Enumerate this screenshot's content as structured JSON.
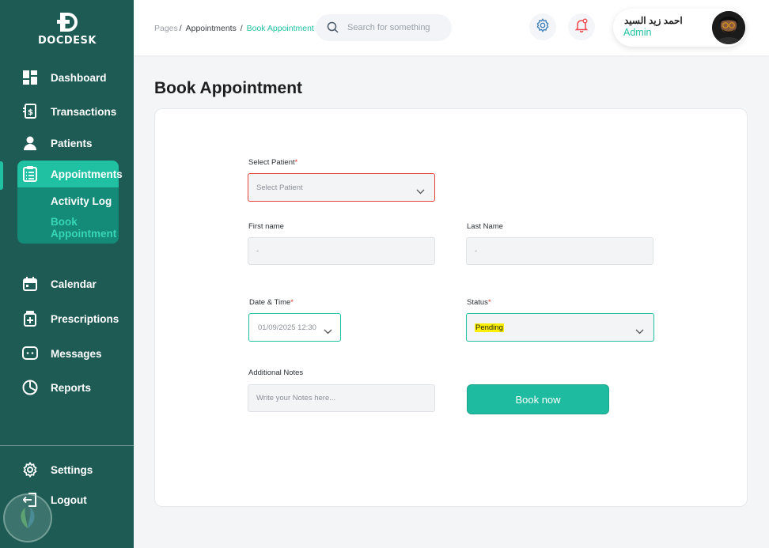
{
  "brand": {
    "name": "DOCDESK"
  },
  "sidebar": {
    "items": [
      {
        "label": "Dashboard",
        "icon": "dashboard-icon"
      },
      {
        "label": "Transactions",
        "icon": "transactions-icon"
      },
      {
        "label": "Patients",
        "icon": "patient-icon"
      },
      {
        "label": "Appointments",
        "icon": "clipboard-icon",
        "active": true
      },
      {
        "label": "Calendar",
        "icon": "calendar-icon"
      },
      {
        "label": "Prescriptions",
        "icon": "prescription-icon"
      },
      {
        "label": "Messages",
        "icon": "message-icon"
      },
      {
        "label": "Reports",
        "icon": "pie-chart-icon"
      }
    ],
    "subitems": [
      {
        "label": "Activity Log"
      },
      {
        "label": "Book Appointment",
        "active": true
      }
    ],
    "bottom": [
      {
        "label": "Settings",
        "icon": "gear-icon"
      },
      {
        "label": "Logout",
        "icon": "logout-icon"
      }
    ]
  },
  "header": {
    "breadcrumb": {
      "root": "Pages",
      "parent": "Appointments",
      "current": "Book Appointment"
    },
    "search_placeholder": "Search for something",
    "user": {
      "name": "احمد زيد السيد",
      "role": "Admin"
    }
  },
  "main": {
    "title": "Book Appointment",
    "form": {
      "patient_label": "Select Patient",
      "patient_placeholder": "Select Patient",
      "first_name_label": "First name",
      "first_name_value": "-",
      "last_name_label": "Last Name",
      "last_name_value": "-",
      "datetime_label": "Date & Time",
      "datetime_value": "01/09/2025 12:30",
      "status_label": "Status",
      "status_value": "Pending",
      "notes_label": "Additional Notes",
      "notes_placeholder": "Write your Notes here...",
      "submit_label": "Book now",
      "required_mark": "*"
    }
  },
  "colors": {
    "sidebar_bg": "#1f5b55",
    "accent": "#20c1a3",
    "required": "#e53935",
    "error_border": "#e3413a"
  }
}
